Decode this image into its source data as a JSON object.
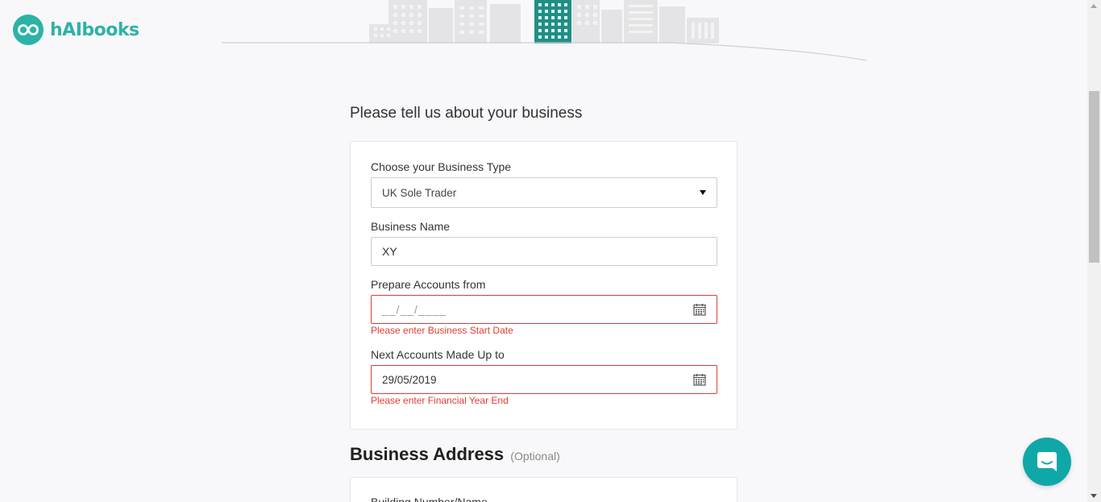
{
  "brand": {
    "name": "hAIbooks",
    "accent": "#2bb3a7"
  },
  "page": {
    "heading": "Please tell us about your business"
  },
  "business_form": {
    "business_type": {
      "label": "Choose your Business Type",
      "value": "UK Sole Trader"
    },
    "business_name": {
      "label": "Business Name",
      "value": "XY"
    },
    "prepare_from": {
      "label": "Prepare Accounts from",
      "placeholder": "__/__/____",
      "error": "Please enter Business Start Date"
    },
    "accounts_to": {
      "label": "Next Accounts Made Up to",
      "value": "29/05/2019",
      "error": "Please enter Financial Year End"
    }
  },
  "address": {
    "title": "Business Address",
    "optional": "(Optional)",
    "first_field_label": "Building Number/Name"
  },
  "colors": {
    "error": "#e03c31",
    "chat": "#10a7a8"
  },
  "icons": {
    "date_picker": "calendar-icon",
    "chat": "chat-icon",
    "logo": "infinity-icon"
  }
}
